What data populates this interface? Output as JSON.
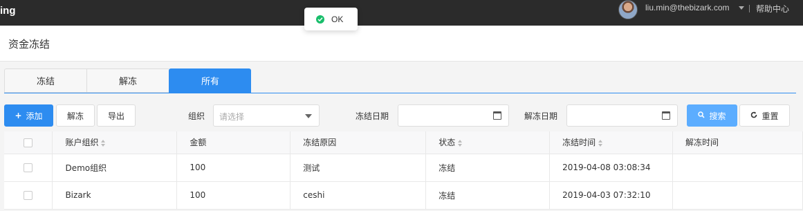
{
  "topbar": {
    "brand": "ing",
    "user_email": "liu.min@thebizark.com",
    "help": "帮助中心"
  },
  "toast": {
    "text": "OK"
  },
  "page": {
    "title": "资金冻结"
  },
  "tabs": [
    {
      "label": "冻结",
      "active": false
    },
    {
      "label": "解冻",
      "active": false
    },
    {
      "label": "所有",
      "active": true
    }
  ],
  "toolbar": {
    "add_label": "添加",
    "unfreeze_label": "解冻",
    "export_label": "导出",
    "org_label": "组织",
    "org_placeholder": "请选择",
    "freeze_date_label": "冻结日期",
    "unfreeze_date_label": "解冻日期",
    "search_label": "搜索",
    "reset_label": "重置"
  },
  "table": {
    "columns": [
      "账户组织",
      "金额",
      "冻结原因",
      "状态",
      "冻结时间",
      "解冻时间"
    ],
    "rows": [
      {
        "org": "Demo组织",
        "amount": "100",
        "reason": "测试",
        "status": "冻结",
        "freeze_time": "2019-04-08 03:08:34",
        "unfreeze_time": ""
      },
      {
        "org": "Bizark",
        "amount": "100",
        "reason": "ceshi",
        "status": "冻结",
        "freeze_time": "2019-04-03 07:32:10",
        "unfreeze_time": ""
      }
    ]
  },
  "colors": {
    "primary": "#2d8cf0",
    "search": "#5cadff",
    "success": "#19be6b",
    "topbar": "#2b2b2b"
  }
}
